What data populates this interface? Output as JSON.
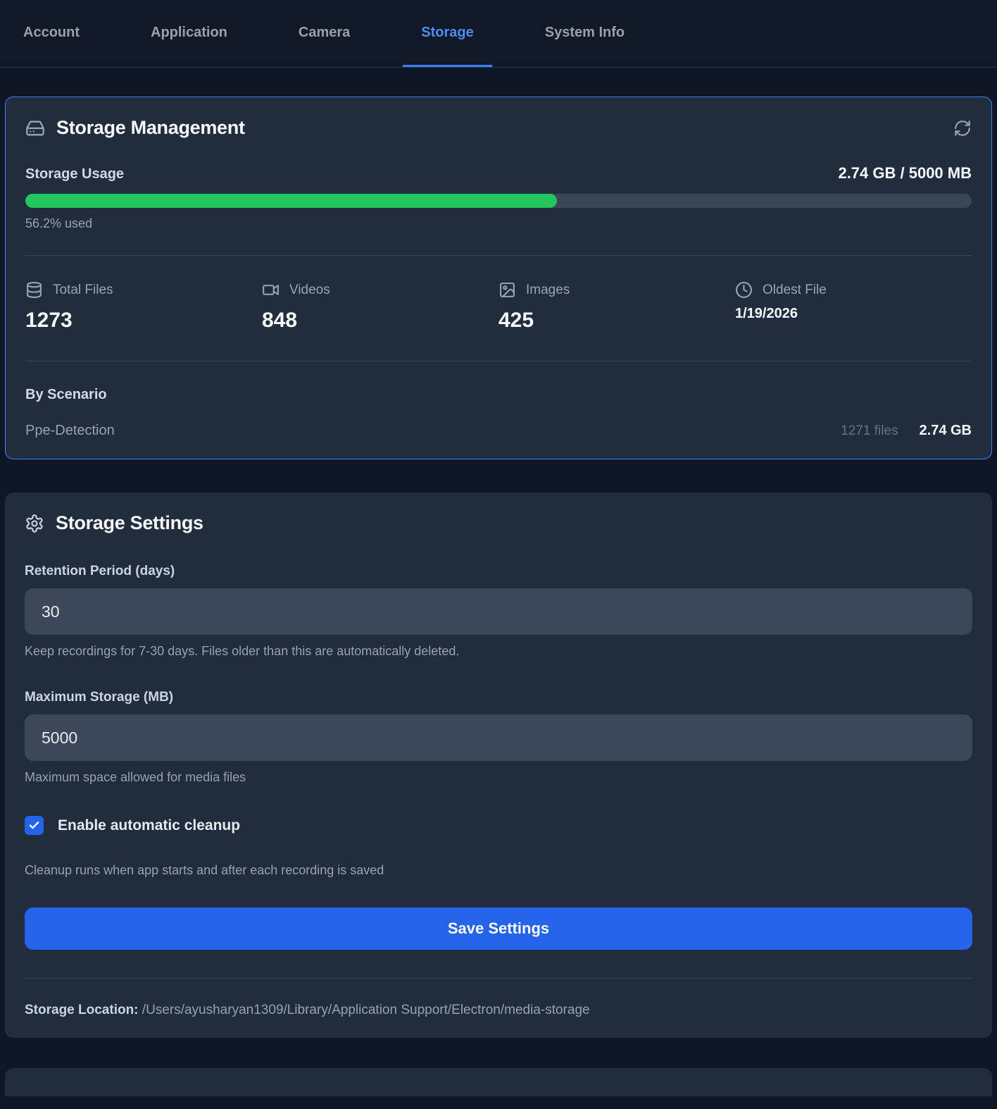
{
  "colors": {
    "page_bg": "#0f1626",
    "card_bg": "#212c3c",
    "accent_border": "#3b82f6",
    "progress_fill": "#22c55e",
    "button_blue": "#2563eb",
    "active_tab": "#4e8cf8"
  },
  "tabs": [
    {
      "label": "Account",
      "active": false
    },
    {
      "label": "Application",
      "active": false
    },
    {
      "label": "Camera",
      "active": false
    },
    {
      "label": "Storage",
      "active": true
    },
    {
      "label": "System Info",
      "active": false
    }
  ],
  "storage_management": {
    "title": "Storage Management",
    "usage_label": "Storage Usage",
    "usage_value": "2.74 GB / 5000 MB",
    "usage_percent": 56.2,
    "usage_percent_label": "56.2% used",
    "stats": [
      {
        "icon": "database-icon",
        "label": "Total Files",
        "value": "1273"
      },
      {
        "icon": "video-icon",
        "label": "Videos",
        "value": "848"
      },
      {
        "icon": "image-icon",
        "label": "Images",
        "value": "425"
      },
      {
        "icon": "clock-icon",
        "label": "Oldest File",
        "value": "1/19/2026"
      }
    ],
    "by_scenario_label": "By Scenario",
    "scenarios": [
      {
        "name": "Ppe-Detection",
        "files": "1271 files",
        "size": "2.74 GB"
      }
    ]
  },
  "storage_settings": {
    "title": "Storage Settings",
    "retention": {
      "label": "Retention Period (days)",
      "value": "30",
      "help": "Keep recordings for 7-30 days. Files older than this are automatically deleted."
    },
    "max_storage": {
      "label": "Maximum Storage (MB)",
      "value": "5000",
      "help": "Maximum space allowed for media files"
    },
    "cleanup": {
      "label": "Enable automatic cleanup",
      "checked": true,
      "help": "Cleanup runs when app starts and after each recording is saved"
    },
    "save_button": "Save Settings",
    "location_label": "Storage Location:",
    "location_path": "/Users/ayusharyan1309/Library/Application Support/Electron/media-storage"
  }
}
